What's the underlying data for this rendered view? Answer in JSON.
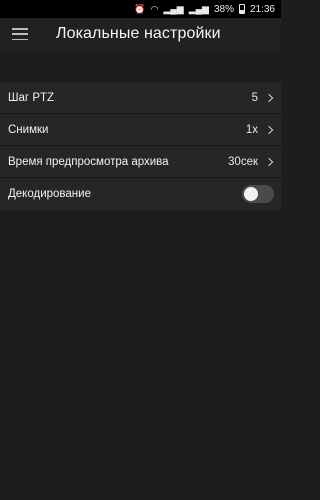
{
  "status_bar": {
    "battery": "38%",
    "time": "21:36",
    "icons": [
      "alarm-icon",
      "wifi-icon",
      "signal-icon",
      "signal-icon",
      "battery-icon"
    ]
  },
  "header": {
    "title": "Локальные настройки",
    "menu_icon": "hamburger-menu-icon"
  },
  "settings": {
    "items": [
      {
        "label": "Шаг PTZ",
        "value": "5"
      },
      {
        "label": "Снимки",
        "value": "1x"
      },
      {
        "label": "Время предпросмотра архива",
        "value": "30сек"
      },
      {
        "label": "Декодирование",
        "toggle": false
      }
    ]
  },
  "colors": {
    "background": "#1d1d1d",
    "list_background": "#262626",
    "toggle_off": "#4a4a4a"
  }
}
